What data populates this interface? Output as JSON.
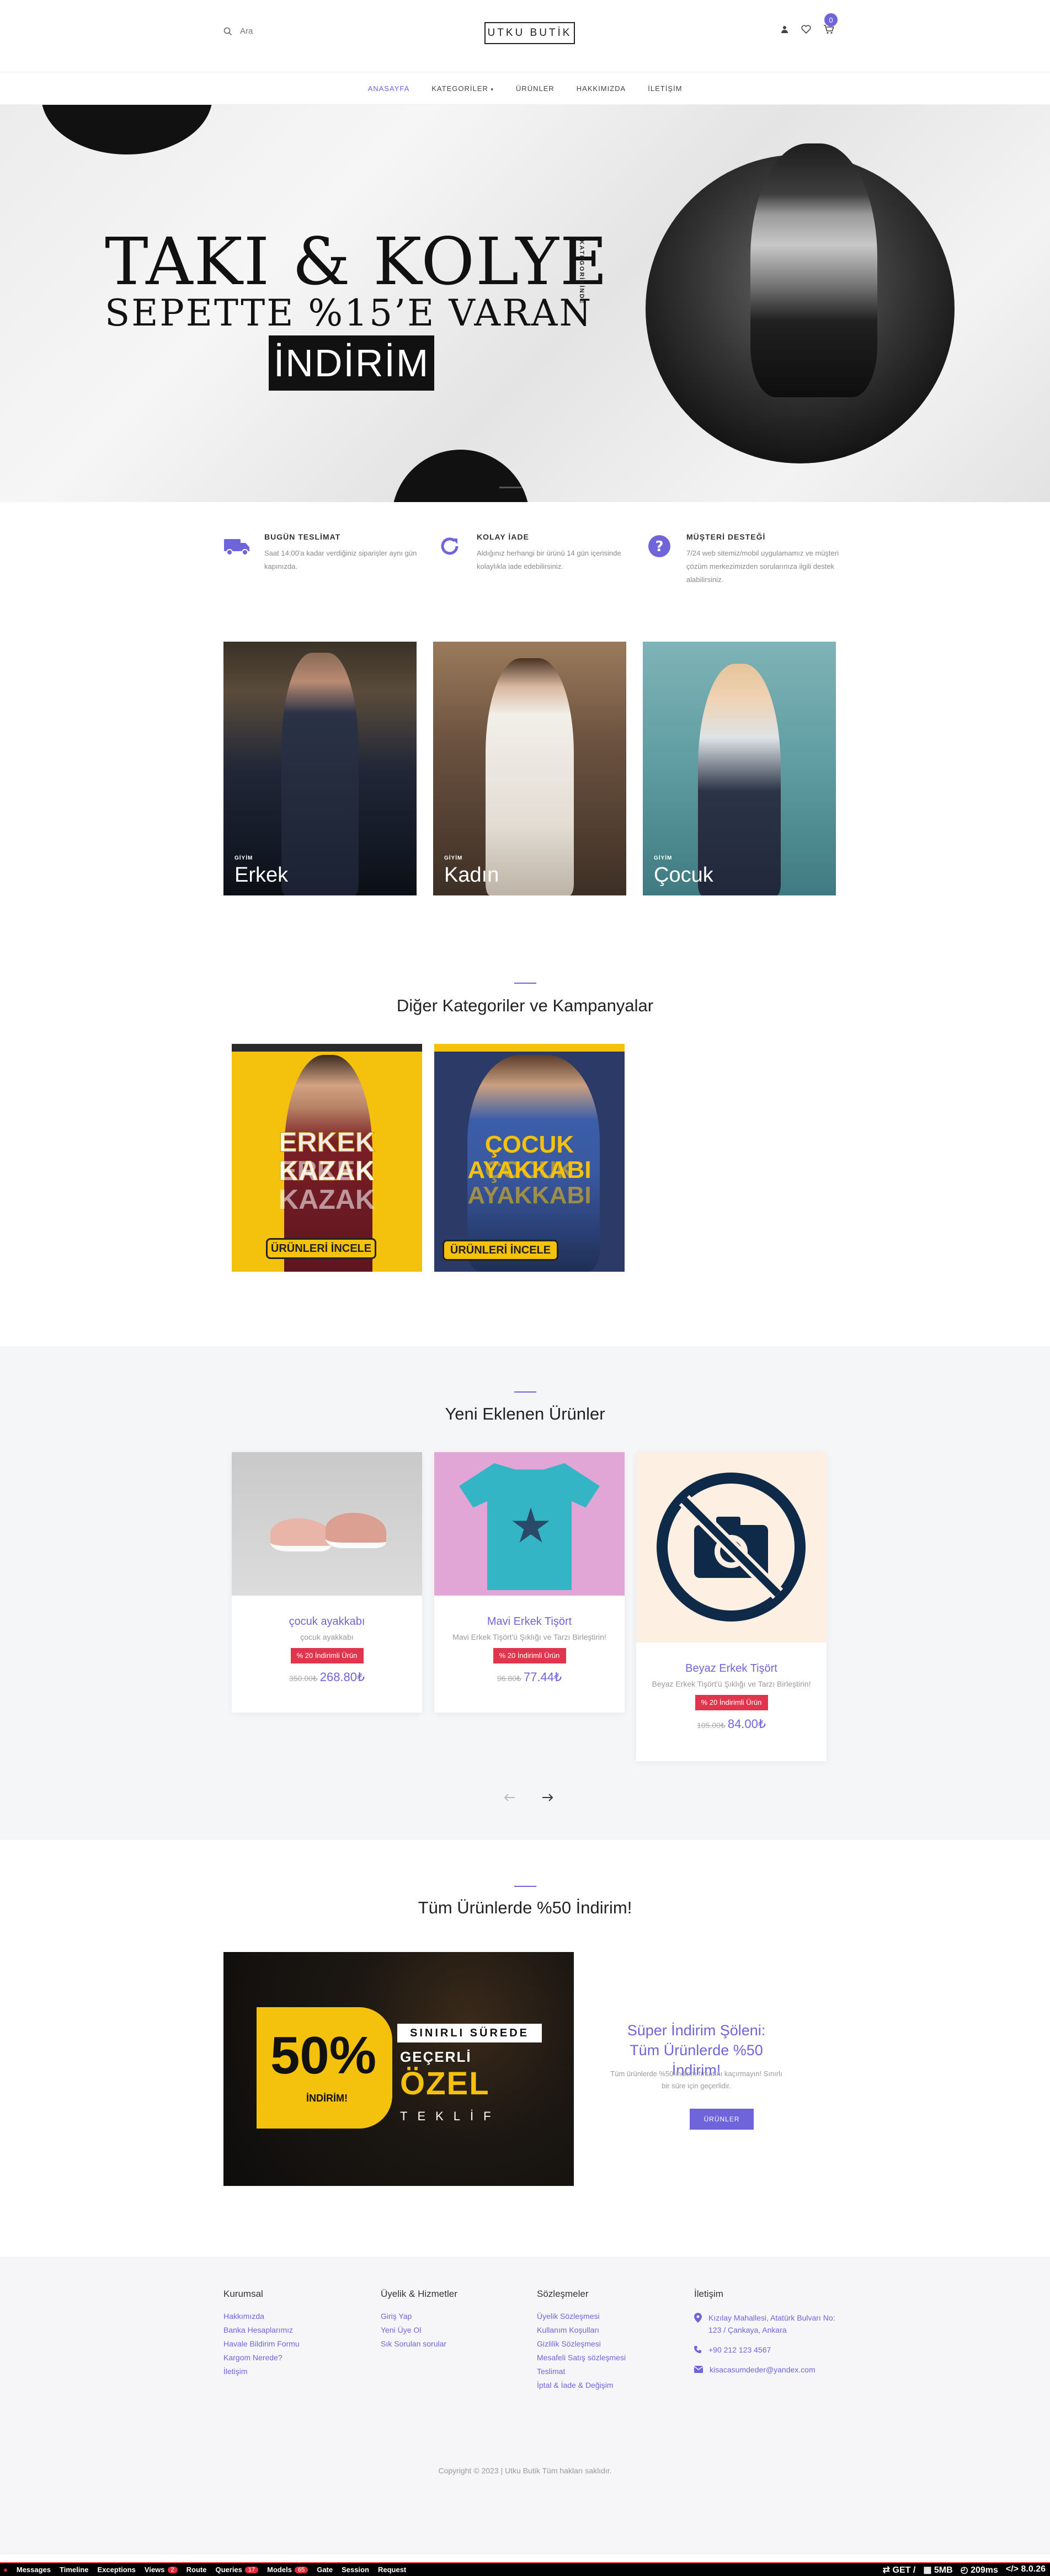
{
  "header": {
    "search_placeholder": "Ara",
    "logo": "UTKU BUTİK",
    "cart_count": "0"
  },
  "nav": {
    "items": [
      "ANASAYFA",
      "KATEGORİLER",
      "ÜRÜNLER",
      "HAKKIMIZDA",
      "İLETİŞİM"
    ]
  },
  "hero": {
    "line1": "TAKI & KOLYE",
    "line2": "SEPETTE %15’E VARAN",
    "highlight": "İNDİRİM",
    "side_label": "KATEGORİSİNDE"
  },
  "features": [
    {
      "title": "BUGÜN TESLİMAT",
      "text": "Saat 14:00'a kadar verdiğiniz siparişler aynı gün kapınızda."
    },
    {
      "title": "KOLAY İADE",
      "text": "Aldığınız herhangi bir ürünü 14 gün içerisinde kolaylıkla iade edebilirsiniz."
    },
    {
      "title": "MÜŞTERİ DESTEĞİ",
      "text": "7/24 web sitemiz/mobil uygulamamız ve müşteri çözüm merkezimizden sorularınıza ilgili destek alabilirsiniz."
    }
  ],
  "categories": [
    {
      "small": "GİYİM",
      "name": "Erkek"
    },
    {
      "small": "GİYİM",
      "name": "Kadın"
    },
    {
      "small": "GİYİM",
      "name": "Çocuk"
    }
  ],
  "other": {
    "title": "Diğer Kategoriler ve Kampanyalar",
    "banners": [
      {
        "text": "ERKEK KAZAK",
        "button": "ÜRÜNLERİ İNCELE"
      },
      {
        "text": "ÇOCUK AYAKKABI",
        "button": "ÜRÜNLERİ İNCELE"
      }
    ]
  },
  "new_products": {
    "title": "Yeni Eklenen Ürünler",
    "items": [
      {
        "name": "çocuk ayakkabı",
        "desc": "çocuk ayakkabı",
        "badge": "% 20 İndirimli Ürün",
        "old": "350.00₺",
        "price": "268.80₺"
      },
      {
        "name": "Mavi Erkek Tişört",
        "desc": "Mavi Erkek Tişört'ü Şıklığı ve Tarzı Birleştirin!",
        "badge": "% 20 İndirimli Ürün",
        "old": "96.80₺",
        "price": "77.44₺"
      },
      {
        "name": "Beyaz Erkek Tişört",
        "desc": "Beyaz Erkek Tişört'ü Şıklığı ve Tarzı Birleştirin!",
        "badge": "% 20 İndirimli Ürün",
        "old": "105.00₺",
        "price": "84.00₺"
      }
    ]
  },
  "promo": {
    "title": "Tüm Ürünlerde %50 İndirim!",
    "banner_big": "50%",
    "banner_sub": "İNDİRİM!",
    "banner_l1": "SINIRLI SÜREDE",
    "banner_l2": "GEÇERLİ",
    "banner_l3": "ÖZEL",
    "banner_l4": "TEKLİF",
    "heading": "Süper İndirim Şöleni: Tüm Ürünlerde %50 İndirim!",
    "text": "Tüm ürünlerde %50 indirim fırsatını kaçırmayın! Sınırlı bir süre için geçerlidir.",
    "button": "ÜRÜNLER"
  },
  "footer": {
    "col1": {
      "title": "Kurumsal",
      "links": [
        "Hakkımızda",
        "Banka Hesaplarımız",
        "Havale Bildirim Formu",
        "Kargom Nerede?",
        "İletişim"
      ]
    },
    "col2": {
      "title": "Üyelik & Hizmetler",
      "links": [
        "Giriş Yap",
        "Yeni Üye Ol",
        "Sık Sorulan sorular"
      ]
    },
    "col3": {
      "title": "Sözleşmeler",
      "links": [
        "Üyelik Sözleşmesi",
        "Kullanım Koşulları",
        "Gizlilik Sözleşmesi",
        "Mesafeli Satış sözleşmesi",
        "Teslimat",
        "İptal & İade & Değişim"
      ]
    },
    "col4": {
      "title": "İletişim",
      "address": "Kızılay Mahallesi, Atatürk Bulvarı No: 123 / Çankaya, Ankara",
      "phone": "+90 212 123 4567",
      "email": "kisacasumdeder@yandex.com"
    },
    "copyright": "Copyright © 2023 | Utku Butik Tüm hakları saklıdır."
  },
  "debugbar": {
    "items": [
      {
        "label": "Messages",
        "count": ""
      },
      {
        "label": "Timeline",
        "count": ""
      },
      {
        "label": "Exceptions",
        "count": ""
      },
      {
        "label": "Views",
        "count": "2"
      },
      {
        "label": "Route",
        "count": ""
      },
      {
        "label": "Queries",
        "count": "17"
      },
      {
        "label": "Models",
        "count": "65"
      },
      {
        "label": "Gate",
        "count": ""
      },
      {
        "label": "Session",
        "count": ""
      },
      {
        "label": "Request",
        "count": ""
      }
    ],
    "method": "GET /",
    "memory": "5MB",
    "time": "209ms",
    "version": "8.0.26"
  }
}
